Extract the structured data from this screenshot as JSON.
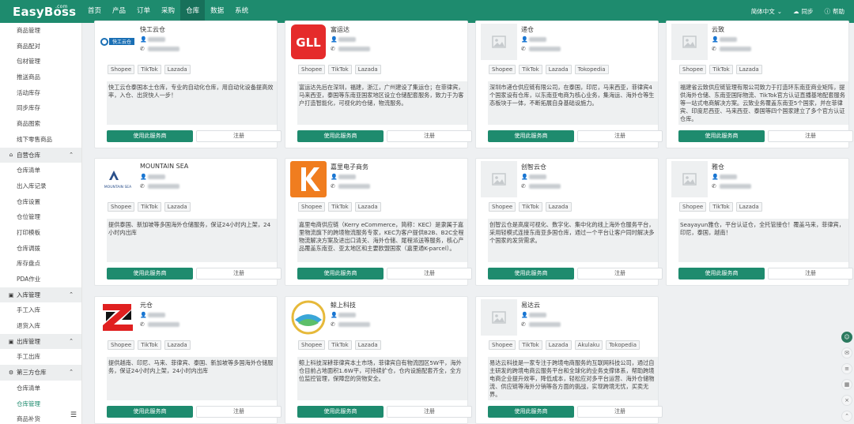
{
  "app": {
    "logo": "EasyBoss",
    "logo_suffix": ".com"
  },
  "nav": [
    "首页",
    "产品",
    "订单",
    "采购",
    "仓库",
    "数据",
    "系统"
  ],
  "nav_active": 4,
  "top_right": {
    "lang": "简体中文",
    "sync": "同步",
    "help": "帮助"
  },
  "sidebar": {
    "items_a": [
      "商品管理",
      "商品配对",
      "包材管理",
      "推送商品",
      "活动库存",
      "同步库存",
      "商品图索",
      "线下零售商品"
    ],
    "group_self": "自营仓库",
    "items_b": [
      "仓库清单",
      "出入库记录",
      "仓库设置",
      "仓位管理",
      "打印模板",
      "仓库调拨",
      "库存盘点",
      "PDA作业"
    ],
    "group_in": "入库管理",
    "items_c": [
      "手工入库",
      "退货入库"
    ],
    "group_out": "出库管理",
    "items_d": [
      "手工出库"
    ],
    "group_third": "第三方仓库",
    "items_e": [
      "仓库清单",
      "仓库管理",
      "商品补货"
    ],
    "active_e": 1
  },
  "buttons": {
    "use": "使用此服务商",
    "register": "注册"
  },
  "cards": [
    {
      "name": "快工云仓",
      "logo": "kuaigong",
      "tags": [
        "Shopee",
        "TikTok",
        "Lazada"
      ],
      "desc": "快工云仓泰国本土仓库，专业的自动化仓库，用自动化设备提高效率，入仓、出货快人一步！"
    },
    {
      "name": "富运达",
      "logo": "gll",
      "tags": [
        "Shopee",
        "TikTok",
        "Lazada"
      ],
      "desc": "富运达先后在深圳，福建，浙江，广州建设了集运仓；在菲律宾，马来西亚，泰国等东南亚国家地区设立仓储配套服务，致力于为客户打造智能化，可视化的仓储，物流服务。"
    },
    {
      "name": "递仓",
      "logo": "placeholder",
      "tags": [
        "Shopee",
        "TikTok",
        "Lazada",
        "Tokopedia"
      ],
      "desc": "深圳市递仓供应链有限公司，在泰国，印尼，马来西亚，菲律宾4个国家设有仓库，以东南亚电商为核心业务，集海运、海外仓等生态板块于一体，不断拓展自身基础设施力。"
    },
    {
      "name": "云致",
      "logo": "placeholder",
      "tags": [
        "Shopee",
        "TikTok",
        "Lazada"
      ],
      "desc": "福建省云致供应链管理有限公司致力于打造环东南亚商业矩阵，提供海外仓储、东南亚国际物流、TikTok官方认证直播基地配套服务等一站式电商解决方案。云致业务覆盖东南亚5个国家，并在菲律宾、印度尼西亚、马来西亚、泰国等四个国家建立了多个官方认证仓库。"
    },
    {
      "name": "MOUNTAIN SEA",
      "logo": "mountain",
      "tags": [
        "Shopee",
        "TikTok",
        "Lazada"
      ],
      "desc": "提供泰国、新加坡等多国海外仓储服务，保证24小时内上架，24小时内出库"
    },
    {
      "name": "嘉里电子商务",
      "logo": "kerry",
      "tags": [
        "Shopee",
        "TikTok",
        "Lazada"
      ],
      "desc": "嘉里电商供应链（Kerry eCommerce，简称：KEC）是隶属于嘉里物流旗下的跨境物流服务专家，KEC为客户提供B2B、B2C全程物流解决方案及进出口清关、海外仓储、尾程派送等服务，核心产品覆盖东南亚、亚太地区和主要欧盟国家（嘉里通K-parcel）。"
    },
    {
      "name": "创智云仓",
      "logo": "placeholder",
      "tags": [
        "Shopee",
        "TikTok",
        "Lazada"
      ],
      "desc": "创智云仓是高度可视化、数字化、集中化的线上海外仓服务平台，采用轻模式连接东南亚多国仓库，通过一个平台让客户同时解决多个国家的发货需求。"
    },
    {
      "name": "雅仓",
      "logo": "placeholder",
      "tags": [
        "Shopee",
        "TikTok",
        "Lazada"
      ],
      "desc": "Seayayun雅仓，平台认证仓，全托管接仓！覆盖马来，菲律宾，印尼，泰国，越南！"
    },
    {
      "name": "元仓",
      "logo": "yuan",
      "tags": [
        "Shopee",
        "TikTok",
        "Lazada"
      ],
      "desc": "提供越南、印尼、马来、菲律宾、泰国、新加坡等多国海外仓储服务，保证24小时内上架，24小时内出库"
    },
    {
      "name": "鲸上科技",
      "logo": "jing",
      "tags": [
        "Shopee",
        "TikTok",
        "Lazada"
      ],
      "desc": "鲸上科技深耕菲律宾本土市场，菲律宾自有物流园区5W平，海外仓目前占地面积1.6W平，可持续扩仓，仓内设施配套齐全，全方位监控管理，保障您的货物安全。"
    },
    {
      "name": "易达云",
      "logo": "placeholder",
      "tags": [
        "Shopee",
        "TikTok",
        "Lazada",
        "Akulaku",
        "Tokopedia"
      ],
      "desc": "易达云科技是一家专注于跨境电商服务的互联网科技公司，通过自主研发的跨境电商云服务平台和全球化的业务支撑体系，帮助跨境电商企业提升效率，降低成本，轻松应对多平台运营、海外仓储物流、供应链等海外分销等各方面的挑战，实现跨境无忧，买卖无界。"
    }
  ],
  "float_tools": [
    "avatar",
    "help-icon",
    "list-icon",
    "grid-icon",
    "close-icon"
  ]
}
